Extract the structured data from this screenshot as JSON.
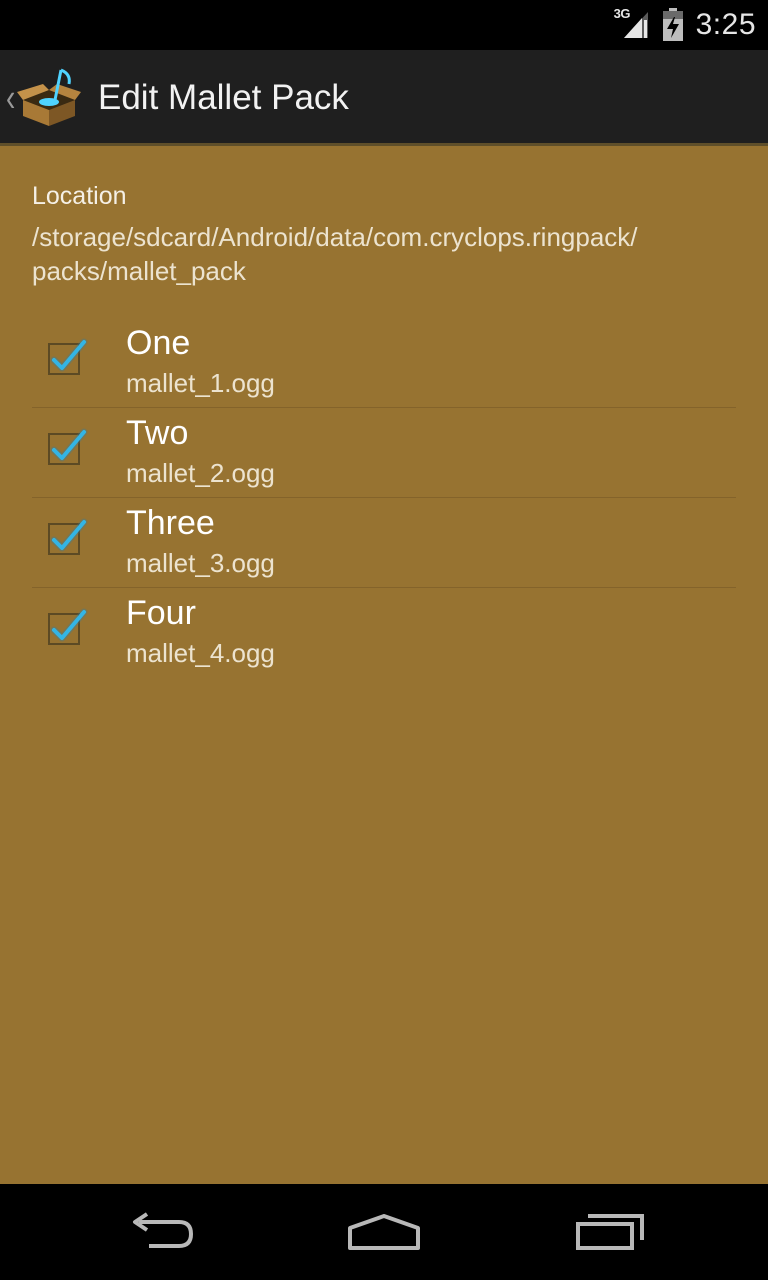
{
  "status_bar": {
    "network_type": "3G",
    "time": "3:25",
    "icons": [
      "signal-icon",
      "battery-charging-icon"
    ]
  },
  "action_bar": {
    "title": "Edit Mallet Pack",
    "up_icon": "chevron-left-icon",
    "app_icon": "box-with-note-icon"
  },
  "location": {
    "label": "Location",
    "path_line1": "/storage/sdcard/Android/data/com.cryclops.ringpack/",
    "path_line2": "packs/mallet_pack"
  },
  "items": [
    {
      "title": "One",
      "file": "mallet_1.ogg",
      "checked": true
    },
    {
      "title": "Two",
      "file": "mallet_2.ogg",
      "checked": true
    },
    {
      "title": "Three",
      "file": "mallet_3.ogg",
      "checked": true
    },
    {
      "title": "Four",
      "file": "mallet_4.ogg",
      "checked": true
    }
  ],
  "nav_bar": {
    "icons": [
      "back-icon",
      "home-icon",
      "recents-icon"
    ]
  },
  "colors": {
    "content_background": "#977331",
    "action_bar": "#1f1f1f",
    "check_accent": "#33b5e5"
  }
}
